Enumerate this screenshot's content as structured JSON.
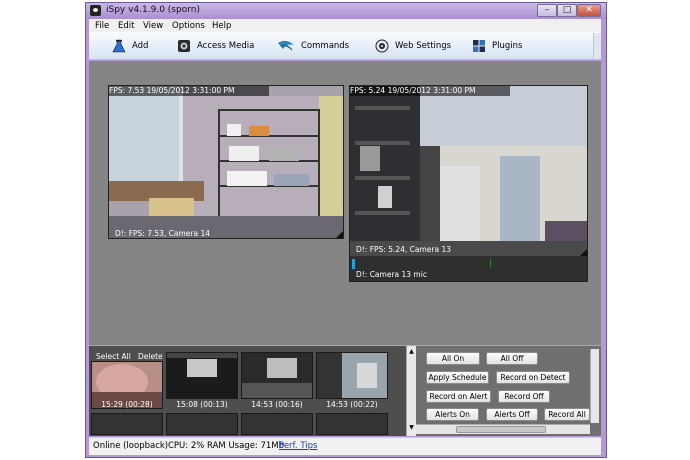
{
  "window": {
    "title": "iSpy v4.1.9.0 (sporn)",
    "min_glyph": "–",
    "max_glyph": "□",
    "close_glyph": "✕"
  },
  "menu": [
    "File",
    "Edit",
    "View",
    "Options",
    "Help"
  ],
  "toolbar": [
    {
      "label": "Add",
      "icon": "flask-icon"
    },
    {
      "label": "Access Media",
      "icon": "media-icon"
    },
    {
      "label": "Commands",
      "icon": "commands-icon"
    },
    {
      "label": "Web Settings",
      "icon": "web-icon"
    },
    {
      "label": "Plugins",
      "icon": "plugins-icon"
    }
  ],
  "cameras": [
    {
      "overlay": "FPS: 7.53 19/05/2012 3:31:00 PM",
      "caption": "D!: FPS: 7.53, Camera 14"
    },
    {
      "overlay": "FPS: 5.24 19/05/2012 3:31:00 PM",
      "caption": "D!: FPS: 5.24, Camera 13",
      "mic_caption": "D!: Camera 13 mic"
    }
  ],
  "thumbnails": {
    "select_all": "Select All",
    "delete": "Delete",
    "items": [
      "15:29 (00:28)",
      "15:08 (00:13)",
      "14:53 (00:16)",
      "14:53 (00:22)"
    ]
  },
  "controls": [
    "All On",
    "All Off",
    "Apply Schedule",
    "Record on Detect",
    "Record on Alert",
    "Record Off",
    "Alerts On",
    "Alerts Off",
    "Record All"
  ],
  "status": {
    "left": "Online (loopback)",
    "metrics": "CPU: 2% RAM Usage: 71Mb",
    "perf_tips": "Perf. Tips"
  }
}
